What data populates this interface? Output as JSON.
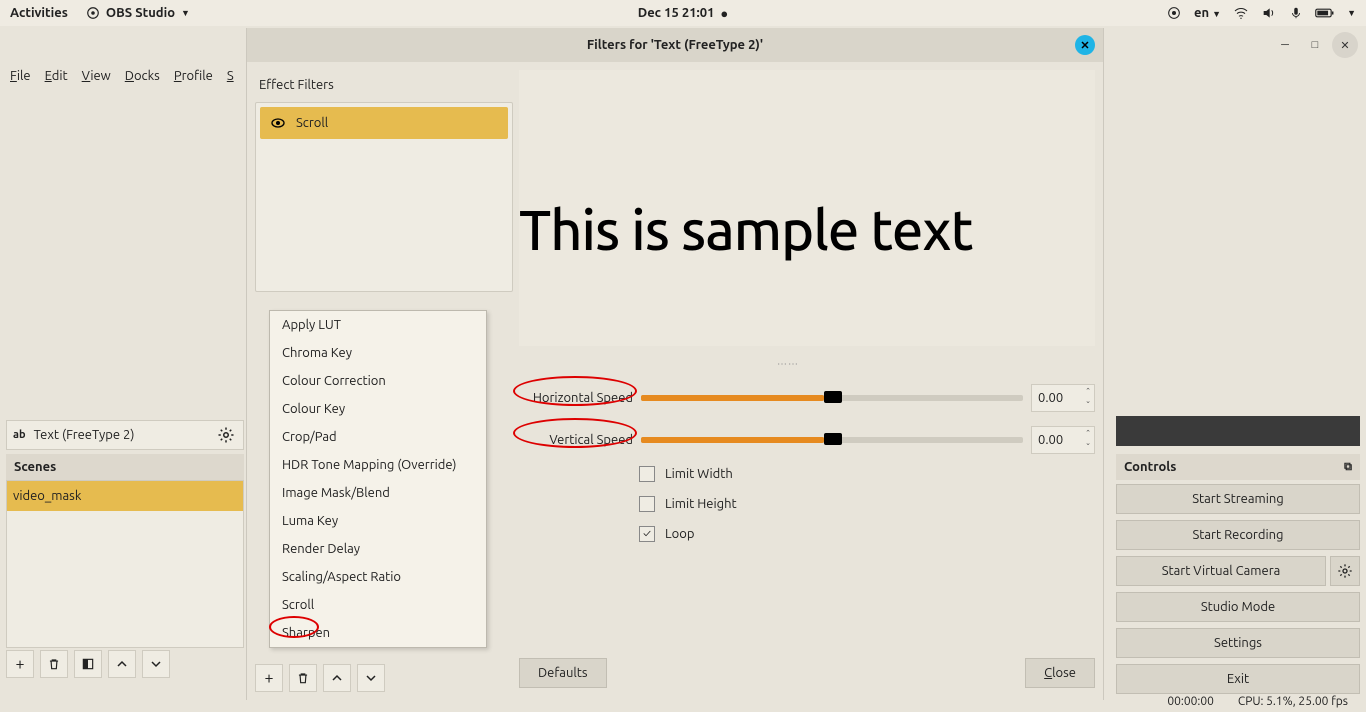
{
  "topbar": {
    "activities": "Activities",
    "app_name": "OBS Studio",
    "datetime": "Dec 15  21:01",
    "lang": "en"
  },
  "obs": {
    "menu": {
      "file": "File",
      "edit": "Edit",
      "view": "View",
      "docks": "Docks",
      "profile": "Profile",
      "scene_collection": "S"
    },
    "source_name": "Text (FreeType 2)",
    "scenes_header": "Scenes",
    "scene_item": "video_mask",
    "controls_header": "Controls",
    "controls": {
      "start_streaming": "Start Streaming",
      "start_recording": "Start Recording",
      "start_virtual_camera": "Start Virtual Camera",
      "studio_mode": "Studio Mode",
      "settings": "Settings",
      "exit": "Exit"
    },
    "status": {
      "time": "00:00:00",
      "cpu": "CPU: 5.1%, 25.00 fps"
    }
  },
  "dialog": {
    "title": "Filters for 'Text (FreeType 2)'",
    "effect_filters_label": "Effect Filters",
    "selected_filter": "Scroll",
    "preview_text": "This is sample text",
    "hspeed_label": "Horizontal Speed",
    "vspeed_label": "Vertical Speed",
    "hspeed_value": "0.00",
    "vspeed_value": "0.00",
    "limit_width": "Limit Width",
    "limit_height": "Limit Height",
    "loop": "Loop",
    "defaults_btn": "Defaults",
    "close_btn": "Close"
  },
  "context_menu": {
    "items": [
      "Apply LUT",
      "Chroma Key",
      "Colour Correction",
      "Colour Key",
      "Crop/Pad",
      "HDR Tone Mapping (Override)",
      "Image Mask/Blend",
      "Luma Key",
      "Render Delay",
      "Scaling/Aspect Ratio",
      "Scroll",
      "Sharpen"
    ]
  }
}
